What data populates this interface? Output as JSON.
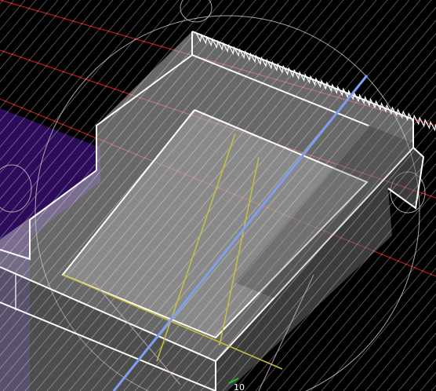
{
  "viewport": {
    "name": "3d-viewport",
    "background": "#000000"
  },
  "colors": {
    "gizmo_circle": "#bfbfbf",
    "red_axis": "#c41a1a",
    "blue_axis": "#7f9ff0",
    "yellow_edge": "#c8c23a",
    "pink_edge": "#c8a0c8",
    "green_marker": "#29c229",
    "purple_panel": "#2c0c5a",
    "box_edge": "#ffffff",
    "box_face": "#bdbdbd",
    "hatch": "#ffffff"
  },
  "measure": {
    "readout": "10"
  }
}
